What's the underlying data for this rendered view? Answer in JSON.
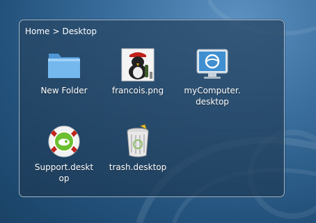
{
  "breadcrumb": {
    "parts": [
      "Home",
      "Desktop"
    ],
    "separator": ">"
  },
  "items": [
    {
      "label": "New Folder",
      "icon": "folder-icon"
    },
    {
      "label": "francois.png",
      "icon": "penguin-image-icon"
    },
    {
      "label": "myComputer.\ndesktop",
      "icon": "computer-monitor-icon"
    },
    {
      "label": "Support.deskt\nop",
      "icon": "lifebuoy-support-icon"
    },
    {
      "label": "trash.desktop",
      "icon": "trash-icon"
    }
  ],
  "colors": {
    "background": "#2f6391",
    "panel_border": "#d2e4f5",
    "folder": "#6fb3ea",
    "support_green": "#6cbf2e"
  }
}
